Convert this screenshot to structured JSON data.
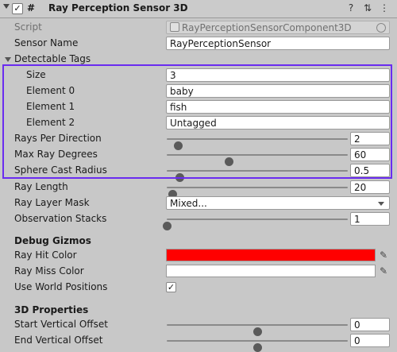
{
  "header": {
    "title": "Ray Perception Sensor 3D",
    "checkbox_mark": "✓",
    "component_glyph": "#",
    "help_icon": "help-icon",
    "presets_icon": "presets-icon",
    "menu_icon": "menu-icon"
  },
  "fields": {
    "script_label": "Script",
    "script_value": "RayPerceptionSensorComponent3D",
    "sensor_name_label": "Sensor Name",
    "sensor_name_value": "RayPerceptionSensor",
    "detectable_tags_label": "Detectable Tags",
    "size_label": "Size",
    "size_value": "3",
    "element0_label": "Element 0",
    "element0_value": "baby",
    "element1_label": "Element 1",
    "element1_value": "fish",
    "element2_label": "Element 2",
    "element2_value": "Untagged",
    "rays_label": "Rays Per Direction",
    "rays_value": "2",
    "max_deg_label": "Max Ray Degrees",
    "max_deg_value": "60",
    "sphere_label": "Sphere Cast Radius",
    "sphere_value": "0.5",
    "ray_length_label": "Ray Length",
    "ray_length_value": "20",
    "layer_mask_label": "Ray Layer Mask",
    "layer_mask_value": "Mixed...",
    "obs_label": "Observation Stacks",
    "obs_value": "1",
    "debug_title": "Debug Gizmos",
    "hit_color_label": "Ray Hit Color",
    "miss_color_label": "Ray Miss Color",
    "world_pos_label": "Use World Positions",
    "world_pos_mark": "✓",
    "props_title": "3D Properties",
    "start_off_label": "Start Vertical Offset",
    "start_off_value": "0",
    "end_off_label": "End Vertical Offset",
    "end_off_value": "0"
  },
  "slider_levels": {
    "rays_per_direction": 0.06,
    "max_ray_degrees": 0.34,
    "sphere_cast_radius": 0.07,
    "ray_length": 0.03,
    "observation_stacks": 0.0,
    "start_vertical_offset": 0.5,
    "end_vertical_offset": 0.5
  },
  "colors": {
    "ray_hit_color": "#ff0000",
    "ray_miss_color": "#ffffff",
    "highlight_border": "#6a2cf0"
  }
}
